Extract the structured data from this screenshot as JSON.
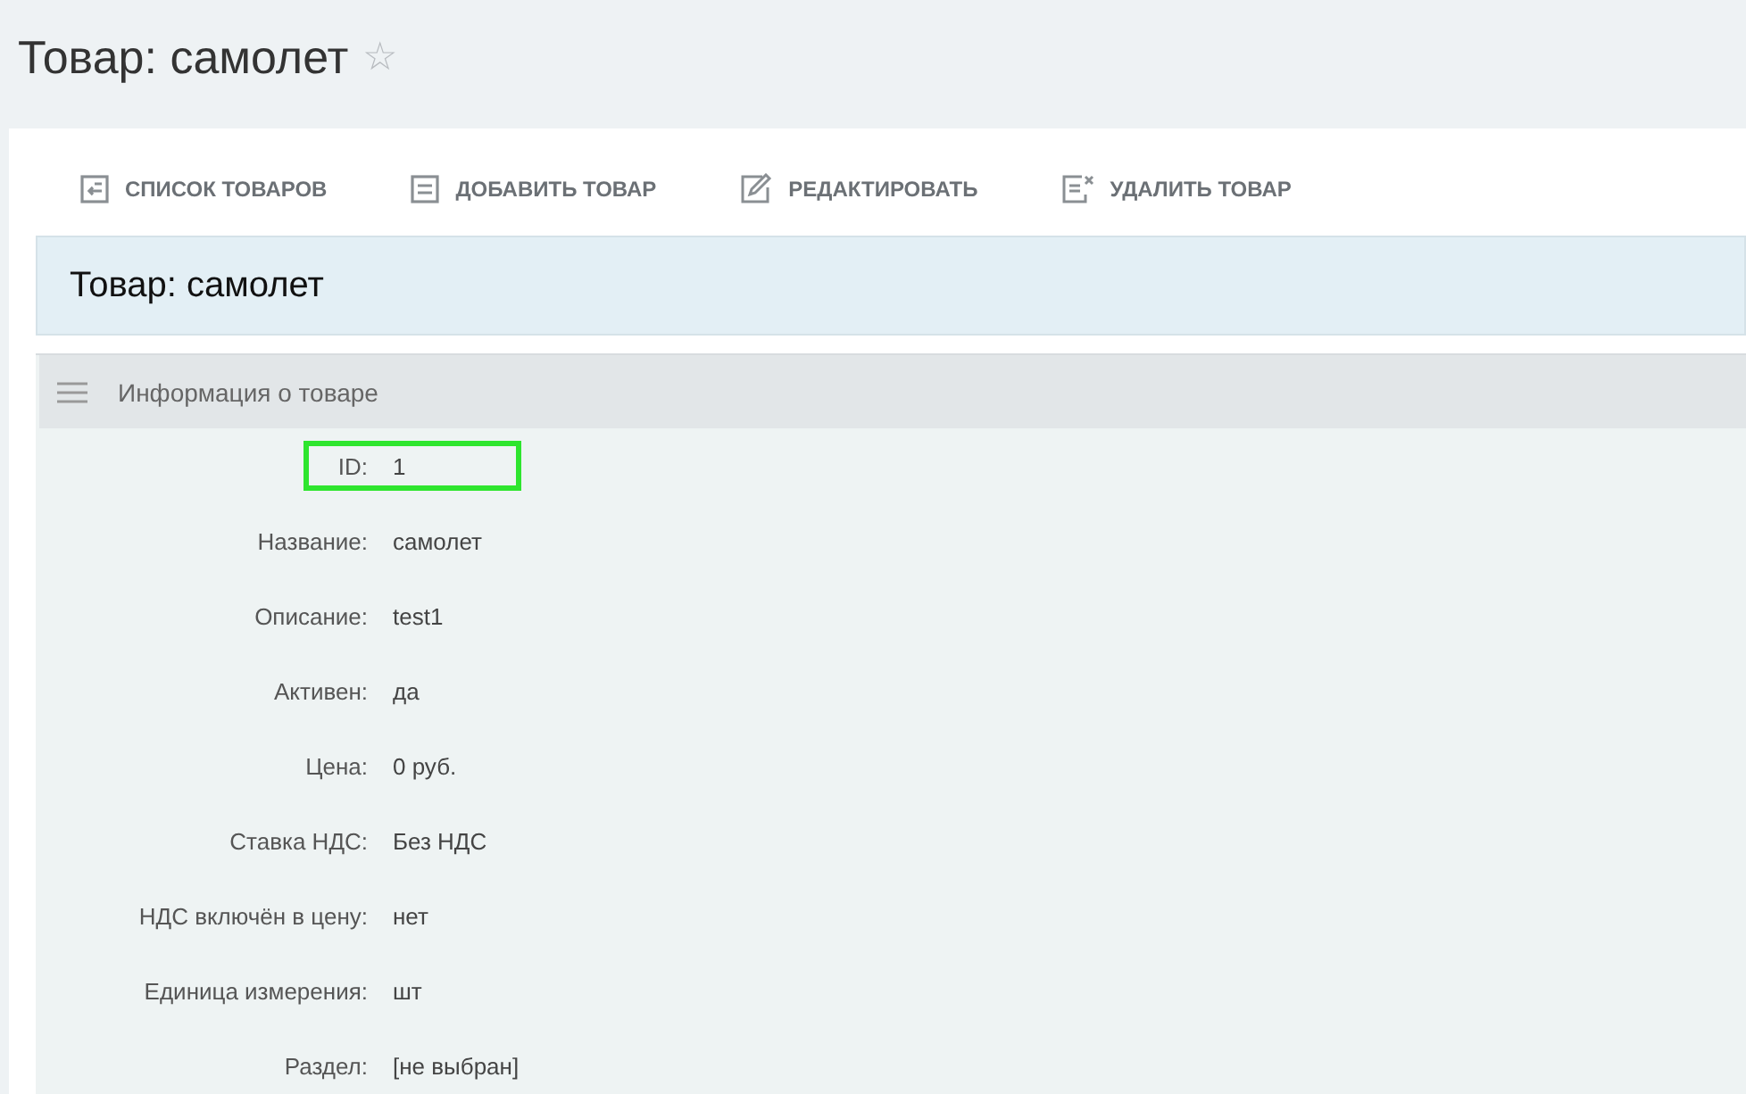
{
  "page_title": "Товар: самолет",
  "favorite_star": "☆",
  "toolbar": [
    {
      "kind": "list",
      "label": "СПИСОК ТОВАРОВ"
    },
    {
      "kind": "add",
      "label": "ДОБАВИТЬ ТОВАР"
    },
    {
      "kind": "edit",
      "label": "РЕДАКТИРОВАТЬ"
    },
    {
      "kind": "delete",
      "label": "УДАЛИТЬ ТОВАР"
    }
  ],
  "header": "Товар: самолет",
  "section": {
    "title": "Информация о товаре",
    "fields": [
      {
        "label": "ID:",
        "value": "1",
        "highlighted": true
      },
      {
        "label": "Название:",
        "value": "самолет",
        "highlighted": false
      },
      {
        "label": "Описание:",
        "value": "test1",
        "highlighted": false
      },
      {
        "label": "Активен:",
        "value": "да",
        "highlighted": false
      },
      {
        "label": "Цена:",
        "value": "0 руб.",
        "highlighted": false
      },
      {
        "label": "Ставка НДС:",
        "value": "Без НДС",
        "highlighted": false
      },
      {
        "label": "НДС включён в цену:",
        "value": "нет",
        "highlighted": false
      },
      {
        "label": "Единица измерения:",
        "value": "шт",
        "highlighted": false
      },
      {
        "label": "Раздел:",
        "value": "[не выбран]",
        "highlighted": false
      }
    ]
  }
}
